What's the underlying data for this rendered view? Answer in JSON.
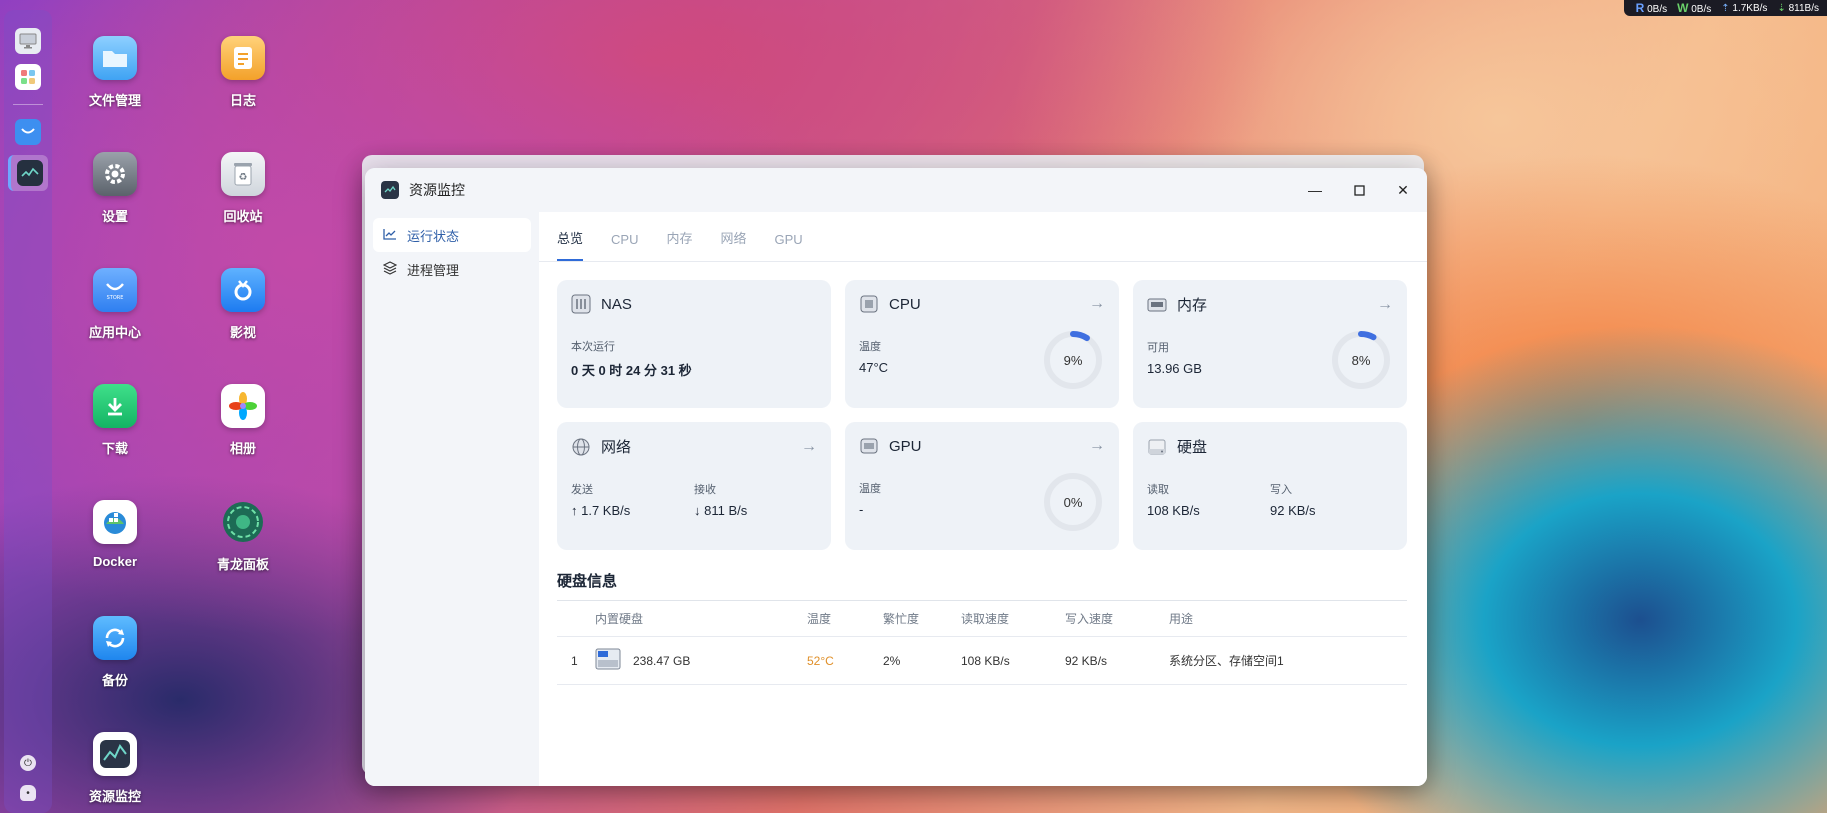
{
  "netbar": {
    "read_label": "R",
    "read_value": "0B/s",
    "write_label": "W",
    "write_value": "0B/s",
    "up_value": "1.7KB/s",
    "down_value": "811B/s"
  },
  "desktop": {
    "icons": [
      {
        "label": "文件管理"
      },
      {
        "label": "日志"
      },
      {
        "label": "设置"
      },
      {
        "label": "回收站"
      },
      {
        "label": "应用中心"
      },
      {
        "label": "影视"
      },
      {
        "label": "下载"
      },
      {
        "label": "相册"
      },
      {
        "label": "Docker"
      },
      {
        "label": "青龙面板"
      },
      {
        "label": "备份"
      },
      {
        "label": "资源监控"
      }
    ]
  },
  "window": {
    "title": "资源监控",
    "sidebar": [
      {
        "label": "运行状态"
      },
      {
        "label": "进程管理"
      }
    ],
    "tabs": [
      {
        "label": "总览"
      },
      {
        "label": "CPU"
      },
      {
        "label": "内存"
      },
      {
        "label": "网络"
      },
      {
        "label": "GPU"
      }
    ],
    "cards": {
      "nas": {
        "title": "NAS",
        "label": "本次运行",
        "value": "0 天 0 时 24 分 31 秒"
      },
      "cpu": {
        "title": "CPU",
        "label": "温度",
        "value": "47°C",
        "percent_text": "9%",
        "percent": 9
      },
      "mem": {
        "title": "内存",
        "label": "可用",
        "value": "13.96 GB",
        "percent_text": "8%",
        "percent": 8
      },
      "net": {
        "title": "网络",
        "send_label": "发送",
        "send_value": "↑ 1.7 KB/s",
        "recv_label": "接收",
        "recv_value": "↓ 811 B/s"
      },
      "gpu": {
        "title": "GPU",
        "label": "温度",
        "value": "-",
        "percent_text": "0%",
        "percent": 0
      },
      "disk": {
        "title": "硬盘",
        "read_label": "读取",
        "read_value": "108 KB/s",
        "write_label": "写入",
        "write_value": "92 KB/s"
      }
    },
    "disk_info": {
      "title": "硬盘信息",
      "headers": [
        "内置硬盘",
        "温度",
        "繁忙度",
        "读取速度",
        "写入速度",
        "用途"
      ],
      "rows": [
        {
          "index": "1",
          "size": "238.47 GB",
          "temp": "52°C",
          "busy": "2%",
          "read": "108 KB/s",
          "write": "92 KB/s",
          "usage": "系统分区、存储空间1"
        }
      ]
    }
  },
  "colors": {
    "accent": "#2f6bd8",
    "ring_progress": "#3f6fe0",
    "temp_warn": "#e0902a"
  }
}
